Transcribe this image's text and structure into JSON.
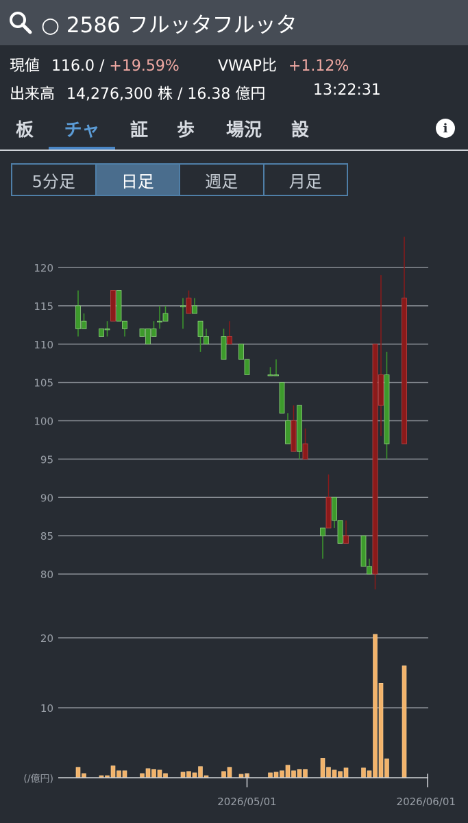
{
  "header": {
    "title": "○ 2586 フルッタフルッタ"
  },
  "quote": {
    "price_label": "現値",
    "price": "116.0",
    "sep": "/",
    "change_pct": "+19.59%",
    "vwap_label": "VWAP比",
    "vwap_pct": "+1.12%",
    "volume_label": "出来高",
    "volume": "14,276,300 株 / 16.38 億円",
    "time": "13:22:31"
  },
  "tabs": [
    {
      "label": "板"
    },
    {
      "label": "チャ"
    },
    {
      "label": "証"
    },
    {
      "label": "歩"
    },
    {
      "label": "場況"
    },
    {
      "label": "設"
    }
  ],
  "active_tab": 1,
  "info_icon": "i",
  "periods": [
    {
      "label": "5分足"
    },
    {
      "label": "日足"
    },
    {
      "label": "週足"
    },
    {
      "label": "月足"
    }
  ],
  "active_period": 1,
  "colors": {
    "up": "#3d9a2c",
    "down": "#8b1a1a",
    "volume": "#f2b36b",
    "accent": "#4a86c5"
  },
  "chart_data": [
    {
      "type": "candlestick",
      "yticks": [
        120,
        115,
        110,
        105,
        100,
        95,
        90,
        85,
        80
      ],
      "ylim": [
        78,
        125
      ],
      "x_tick_labels": [
        {
          "index": 30,
          "label": "2026/05/01"
        },
        {
          "index": 61,
          "label": "2026/06/01"
        }
      ],
      "candles": [
        {
          "i": 1,
          "o": 112,
          "h": 117,
          "l": 111,
          "c": 115
        },
        {
          "i": 2,
          "o": 112,
          "h": 114,
          "l": 112,
          "c": 113
        },
        {
          "i": 5,
          "o": 111,
          "h": 112,
          "l": 111,
          "c": 112
        },
        {
          "i": 6,
          "o": 112,
          "h": 113,
          "l": 111,
          "c": 112
        },
        {
          "i": 7,
          "o": 117,
          "h": 117,
          "l": 113,
          "c": 113
        },
        {
          "i": 8,
          "o": 113,
          "h": 117,
          "l": 113,
          "c": 117
        },
        {
          "i": 9,
          "o": 112,
          "h": 113,
          "l": 111,
          "c": 113
        },
        {
          "i": 12,
          "o": 111,
          "h": 112,
          "l": 111,
          "c": 112
        },
        {
          "i": 13,
          "o": 110,
          "h": 112,
          "l": 110,
          "c": 112
        },
        {
          "i": 14,
          "o": 111,
          "h": 113,
          "l": 111,
          "c": 112
        },
        {
          "i": 15,
          "o": 113,
          "h": 115,
          "l": 112,
          "c": 113
        },
        {
          "i": 16,
          "o": 113,
          "h": 115,
          "l": 113,
          "c": 114
        },
        {
          "i": 19,
          "o": 115,
          "h": 116,
          "l": 112,
          "c": 115
        },
        {
          "i": 20,
          "o": 116,
          "h": 117,
          "l": 114,
          "c": 114
        },
        {
          "i": 21,
          "o": 114,
          "h": 116,
          "l": 114,
          "c": 115
        },
        {
          "i": 22,
          "o": 111,
          "h": 113,
          "l": 109,
          "c": 113
        },
        {
          "i": 23,
          "o": 110,
          "h": 112,
          "l": 110,
          "c": 111
        },
        {
          "i": 26,
          "o": 108,
          "h": 112,
          "l": 108,
          "c": 111
        },
        {
          "i": 27,
          "o": 111,
          "h": 113,
          "l": 110,
          "c": 110
        },
        {
          "i": 29,
          "o": 108,
          "h": 110,
          "l": 108,
          "c": 110
        },
        {
          "i": 30,
          "o": 106,
          "h": 108,
          "l": 106,
          "c": 108
        },
        {
          "i": 34,
          "o": 106,
          "h": 107,
          "l": 106,
          "c": 106
        },
        {
          "i": 35,
          "o": 106,
          "h": 108,
          "l": 106,
          "c": 106
        },
        {
          "i": 36,
          "o": 101,
          "h": 105,
          "l": 101,
          "c": 105
        },
        {
          "i": 37,
          "o": 97,
          "h": 101,
          "l": 97,
          "c": 100
        },
        {
          "i": 38,
          "o": 100,
          "h": 102,
          "l": 96,
          "c": 96
        },
        {
          "i": 39,
          "o": 96,
          "h": 102,
          "l": 95,
          "c": 102
        },
        {
          "i": 40,
          "o": 97,
          "h": 99,
          "l": 95,
          "c": 95
        },
        {
          "i": 43,
          "o": 85,
          "h": 86,
          "l": 82,
          "c": 86
        },
        {
          "i": 44,
          "o": 90,
          "h": 93,
          "l": 86,
          "c": 86
        },
        {
          "i": 45,
          "o": 87,
          "h": 90,
          "l": 86,
          "c": 90
        },
        {
          "i": 46,
          "o": 84,
          "h": 87,
          "l": 84,
          "c": 87
        },
        {
          "i": 47,
          "o": 85,
          "h": 87,
          "l": 84,
          "c": 84
        },
        {
          "i": 50,
          "o": 81,
          "h": 85,
          "l": 81,
          "c": 85
        },
        {
          "i": 51,
          "o": 80,
          "h": 82,
          "l": 80,
          "c": 81
        },
        {
          "i": 52,
          "o": 110,
          "h": 110,
          "l": 78,
          "c": 80
        },
        {
          "i": 53,
          "o": 106,
          "h": 119,
          "l": 98,
          "c": 102
        },
        {
          "i": 54,
          "o": 97,
          "h": 109,
          "l": 95,
          "c": 106
        },
        {
          "i": 57,
          "o": 116,
          "h": 124,
          "l": 97,
          "c": 97
        }
      ]
    },
    {
      "type": "bar",
      "ylabel": "(/億円)",
      "yticks": [
        20,
        10
      ],
      "ylim": [
        0,
        22
      ],
      "values": [
        {
          "i": 1,
          "v": 1.5
        },
        {
          "i": 2,
          "v": 0.6
        },
        {
          "i": 5,
          "v": 0.3
        },
        {
          "i": 6,
          "v": 0.3
        },
        {
          "i": 7,
          "v": 1.7
        },
        {
          "i": 8,
          "v": 1.0
        },
        {
          "i": 9,
          "v": 1.0
        },
        {
          "i": 12,
          "v": 0.6
        },
        {
          "i": 13,
          "v": 1.3
        },
        {
          "i": 14,
          "v": 1.2
        },
        {
          "i": 15,
          "v": 1.1
        },
        {
          "i": 16,
          "v": 0.6
        },
        {
          "i": 19,
          "v": 0.8
        },
        {
          "i": 20,
          "v": 0.9
        },
        {
          "i": 21,
          "v": 0.7
        },
        {
          "i": 22,
          "v": 1.6
        },
        {
          "i": 23,
          "v": 0.3
        },
        {
          "i": 26,
          "v": 0.9
        },
        {
          "i": 27,
          "v": 1.5
        },
        {
          "i": 29,
          "v": 0.5
        },
        {
          "i": 30,
          "v": 0.6
        },
        {
          "i": 34,
          "v": 0.7
        },
        {
          "i": 35,
          "v": 0.8
        },
        {
          "i": 36,
          "v": 1.0
        },
        {
          "i": 37,
          "v": 1.8
        },
        {
          "i": 38,
          "v": 1.0
        },
        {
          "i": 39,
          "v": 1.2
        },
        {
          "i": 40,
          "v": 1.2
        },
        {
          "i": 43,
          "v": 2.8
        },
        {
          "i": 44,
          "v": 1.5
        },
        {
          "i": 45,
          "v": 1.1
        },
        {
          "i": 46,
          "v": 0.9
        },
        {
          "i": 47,
          "v": 1.4
        },
        {
          "i": 50,
          "v": 1.4
        },
        {
          "i": 51,
          "v": 1.0
        },
        {
          "i": 52,
          "v": 20.5
        },
        {
          "i": 53,
          "v": 13.5
        },
        {
          "i": 54,
          "v": 2.7
        },
        {
          "i": 57,
          "v": 16.0
        }
      ]
    }
  ]
}
